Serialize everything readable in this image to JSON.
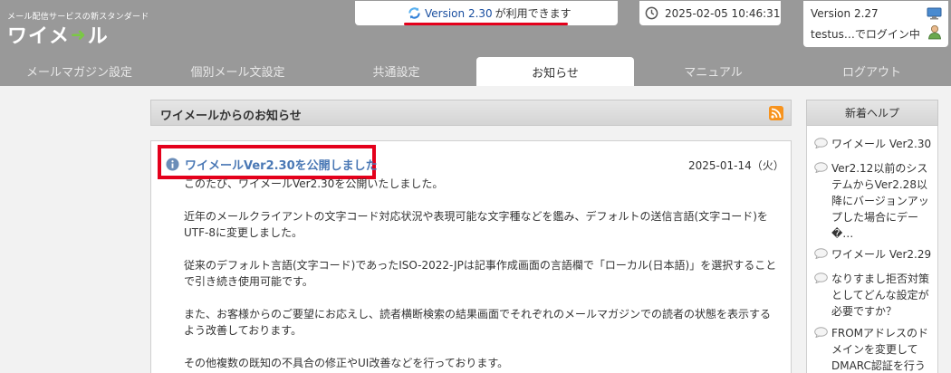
{
  "header": {
    "logo_tagline": "メール配信サービスの新スタンダード",
    "logo_text_left": "ワイメ",
    "logo_text_right": "ル",
    "update_version": "Version 2.30",
    "update_suffix": "が利用できます",
    "datetime": "2025-02-05 10:46:31",
    "current_version": "Version 2.27",
    "login_status": "testus…でログイン中"
  },
  "tabs": [
    {
      "label": "メールマガジン設定"
    },
    {
      "label": "個別メール文設定"
    },
    {
      "label": "共通設定"
    },
    {
      "label": "お知らせ"
    },
    {
      "label": "マニュアル"
    },
    {
      "label": "ログアウト"
    }
  ],
  "main": {
    "section_title": "ワイメールからのお知らせ",
    "news": {
      "title": "ワイメールVer2.30を公開しました",
      "date": "2025-01-14（火）",
      "paragraphs": [
        "このたび、ワイメールVer2.30を公開いたしました。",
        "近年のメールクライアントの文字コード対応状況や表現可能な文字種などを鑑み、デフォルトの送信言語(文字コード)をUTF-8に変更しました。",
        "従来のデフォルト言語(文字コード)であったISO-2022-JPは記事作成画面の言語欄で「ローカル(日本語)」を選択することで引き続き使用可能です。",
        "また、お客様からのご要望にお応えし、読者横断検索の結果画面でそれぞれのメールマガジンでの読者の状態を表示するよう改善しております。",
        "その他複数の既知の不具合の修正やUI改善などを行っております。"
      ]
    }
  },
  "sidebar": {
    "title": "新着ヘルプ",
    "items": [
      {
        "label": "ワイメール Ver2.30"
      },
      {
        "label": "Ver2.12以前のシステムからVer2.28以降にバージョンアップした場合にデー�…"
      },
      {
        "label": "ワイメール Ver2.29"
      },
      {
        "label": "なりすまし拒否対策としてどんな設定が必要ですか？"
      },
      {
        "label": "FROMアドレスのドメインを変更してDMARC認証を行うには"
      }
    ]
  },
  "colors": {
    "header_bg": "#999999",
    "accent_red": "#e4001b",
    "link_blue": "#4a78b5",
    "logo_green": "#7ac943",
    "rss_orange": "#f7931e"
  }
}
